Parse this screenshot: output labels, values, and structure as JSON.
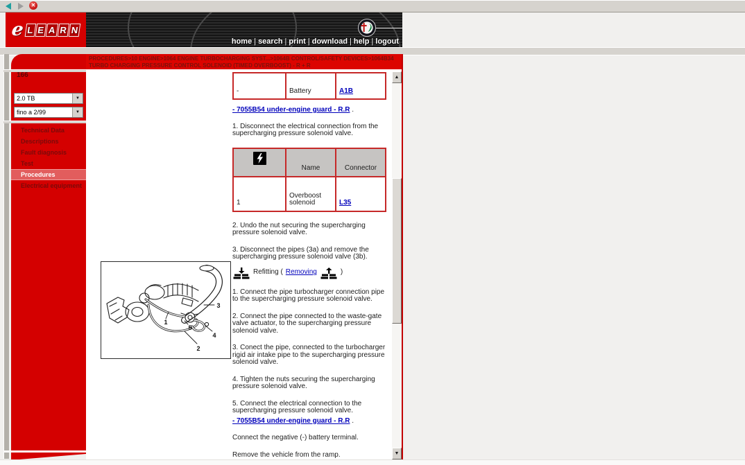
{
  "toolbar": {
    "back_icon": "back-arrow",
    "forward_icon": "forward-arrow",
    "close_icon": "close",
    "close_glyph": "✕"
  },
  "header": {
    "logo_e": "e",
    "logo_letters": [
      "L",
      "E",
      "A",
      "R",
      "N"
    ],
    "nav": [
      "home",
      "search",
      "print",
      "download",
      "help",
      "logout"
    ],
    "nav_sep": "|"
  },
  "breadcrumb": "PROCEDURES>10 ENGINE>1064 ENGINE TURBOCHARGING SYST...>1064B CONTROL/SAFETY DEVICES>1064B34 TURBO CHARGING PRESSURE CONTROL SOLENOID (TIMED OVERBOOST) - R + R",
  "sidebar": {
    "model": "166",
    "dropdowns": [
      {
        "value": "2.0 TB",
        "arrow": "▼"
      },
      {
        "value": "fino a 2/99",
        "arrow": "▼"
      }
    ],
    "menu": [
      {
        "label": "Technical Data"
      },
      {
        "label": "Descriptions"
      },
      {
        "label": "Fault diagnosis"
      },
      {
        "label": "Test"
      },
      {
        "label": "Procedures",
        "active": true
      },
      {
        "label": "Electrical equipment"
      }
    ]
  },
  "content": {
    "table_battery": {
      "rows": [
        [
          "-",
          "Battery",
          "A1B"
        ]
      ]
    },
    "guard_link": {
      "text": "- 7055B54 under-engine guard - R.R",
      "suffix": " ."
    },
    "steps_removal": [
      "1. Disconnect the electrical connection from the supercharging pressure solenoid valve.",
      "2. Undo the nut securing the supercharging pressure solenoid valve.",
      "3. Disconnect the pipes (3a) and remove the supercharging pressure solenoid valve (3b)."
    ],
    "table_connector": {
      "headers": [
        "",
        "Name",
        "Connector"
      ],
      "rows": [
        [
          "1",
          "Overboost solenoid",
          "L35"
        ]
      ]
    },
    "refitting": {
      "label": "Refitting (",
      "removing_link": "Removing",
      "close": ")"
    },
    "steps_refitting": [
      "1. Connect the pipe turbocharger connection pipe to the supercharging pressure solenoid valve.",
      "2. Connect the pipe connected to the waste-gate valve actuator, to the supercharging pressure solenoid valve.",
      "3. Conect the pipe, connected to the turbocharger rigid air intake pipe to the supercharging pressure solenoid valve.",
      "4. Tighten the nuts securing the supercharging pressure solenoid valve.",
      "5. Connect the electrical connection to the supercharging pressure solenoid valve."
    ],
    "closing": [
      "Connect the negative (-) battery terminal.",
      "Remove the vehicle from the ramp."
    ],
    "figure": {
      "labels": [
        "1",
        "2",
        "3",
        "4",
        "5"
      ]
    }
  },
  "colors": {
    "accent_red": "#d40000",
    "breadcrumb_red": "#dc0400",
    "breadcrumb_text": "#7c120c",
    "menu_text": "#7a0a0a",
    "active_item_bg": "#e25d5d",
    "table_border": "#c62828",
    "table_header_bg": "#c6c4c2",
    "link_blue": "#0000bb",
    "window_gray": "#d6d3ce"
  }
}
